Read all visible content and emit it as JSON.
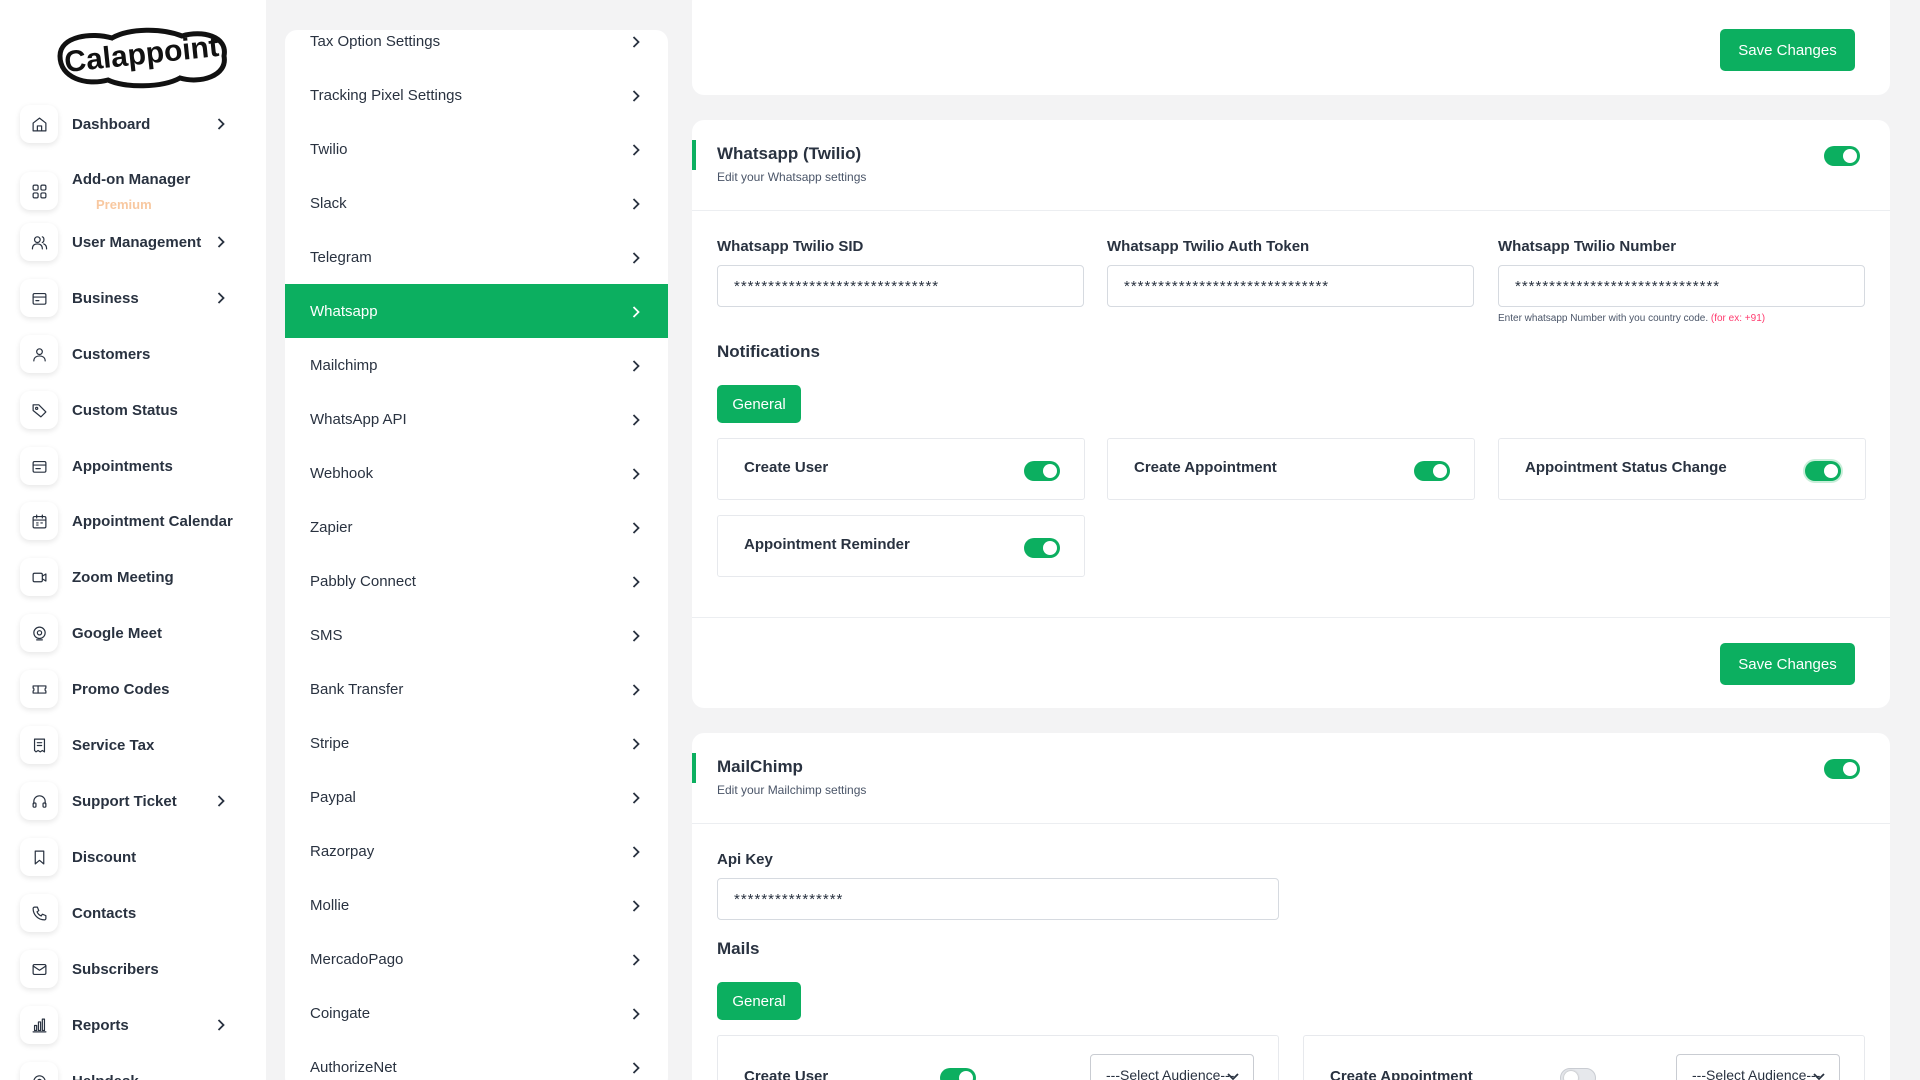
{
  "brand": {
    "logo_text": "Calappoint"
  },
  "sidebar": {
    "items": [
      {
        "label": "Dashboard",
        "icon": "home-icon",
        "chevron": true
      },
      {
        "label": "Add-on Manager",
        "sub": "Premium",
        "icon": "grid-icon",
        "chevron": false
      },
      {
        "label": "User Management",
        "icon": "users-icon",
        "chevron": true
      },
      {
        "label": "Business",
        "icon": "business-icon",
        "chevron": true
      },
      {
        "label": "Customers",
        "icon": "user-icon",
        "chevron": false
      },
      {
        "label": "Custom Status",
        "icon": "tag-icon",
        "chevron": false
      },
      {
        "label": "Appointments",
        "icon": "appointments-icon",
        "chevron": false
      },
      {
        "label": "Appointment Calendar",
        "icon": "calendar-icon",
        "chevron": false
      },
      {
        "label": "Zoom Meeting",
        "icon": "video-icon",
        "chevron": false
      },
      {
        "label": "Google Meet",
        "icon": "meet-icon",
        "chevron": false
      },
      {
        "label": "Promo Codes",
        "icon": "ticket-icon",
        "chevron": false
      },
      {
        "label": "Service Tax",
        "icon": "receipt-icon",
        "chevron": false
      },
      {
        "label": "Support Ticket",
        "icon": "headphones-icon",
        "chevron": true
      },
      {
        "label": "Discount",
        "icon": "bookmark-icon",
        "chevron": false
      },
      {
        "label": "Contacts",
        "icon": "phone-icon",
        "chevron": false
      },
      {
        "label": "Subscribers",
        "icon": "mail-icon",
        "chevron": false
      },
      {
        "label": "Reports",
        "icon": "chart-icon",
        "chevron": true
      },
      {
        "label": "Helpdesk",
        "icon": "helpdesk-icon",
        "chevron": false
      }
    ]
  },
  "settings_menu": {
    "items": [
      "Tax Option Settings",
      "Tracking Pixel Settings",
      "Twilio",
      "Slack",
      "Telegram",
      "Whatsapp",
      "Mailchimp",
      "WhatsApp API",
      "Webhook",
      "Zapier",
      "Pabbly Connect",
      "SMS",
      "Bank Transfer",
      "Stripe",
      "Paypal",
      "Razorpay",
      "Mollie",
      "MercadoPago",
      "Coingate",
      "AuthorizeNet"
    ],
    "active": "Whatsapp"
  },
  "top_card": {
    "save_label": "Save Changes"
  },
  "whatsapp": {
    "title": "Whatsapp (Twilio)",
    "subtitle": "Edit your Whatsapp settings",
    "enabled": true,
    "fields": [
      {
        "label": "Whatsapp Twilio SID",
        "value": "******************************"
      },
      {
        "label": "Whatsapp Twilio Auth Token",
        "value": "******************************"
      },
      {
        "label": "Whatsapp Twilio Number",
        "value": "******************************"
      }
    ],
    "number_help": "Enter whatsapp Number with you country code.",
    "number_help_example": "(for ex: +91)",
    "notifications_heading": "Notifications",
    "tab_label": "General",
    "notifications": [
      {
        "label": "Create User",
        "on": true
      },
      {
        "label": "Create Appointment",
        "on": true
      },
      {
        "label": "Appointment Status Change",
        "on": true
      },
      {
        "label": "Appointment Reminder",
        "on": true
      }
    ],
    "save_label": "Save Changes"
  },
  "mailchimp": {
    "title": "MailChimp",
    "subtitle": "Edit your Mailchimp settings",
    "enabled": true,
    "api_key_label": "Api Key",
    "api_key_value": "****************",
    "mails_heading": "Mails",
    "tab_label": "General",
    "mails": [
      {
        "label": "Create User",
        "on": true,
        "select": "---Select Audience---"
      },
      {
        "label": "Create Appointment",
        "on": false,
        "select": "---Select Audience---"
      }
    ]
  },
  "colors": {
    "accent": "#0caf60",
    "text": "#293240",
    "background": "#f3f3f4",
    "premium": "#f8c8a0"
  }
}
